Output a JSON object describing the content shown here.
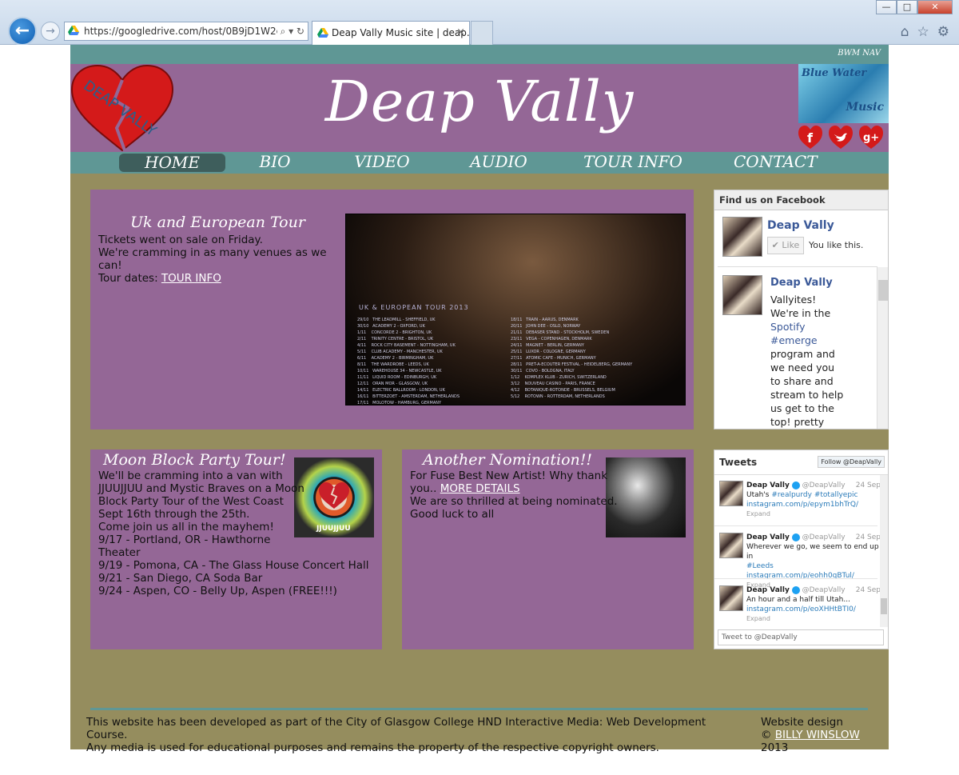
{
  "browser": {
    "url": "https://googledrive.com/host/0B9jD1W2c(",
    "tab_title": "Deap Vally Music site | deap...",
    "tab_close": "×",
    "minimize": "—",
    "maximize": "□",
    "close": "✕",
    "back": "←",
    "forward": "→",
    "addr_controls": "⌕ ▾ ↻",
    "tools": [
      "⌂",
      "☆",
      "⚙"
    ]
  },
  "site": {
    "topbar_label": "BWM NAV",
    "title": "Deap Vally",
    "logo_text": "DEAP VALLY",
    "partner_logo": {
      "line1": "Blue Water",
      "line2": "Music"
    },
    "socials": [
      "facebook-icon",
      "twitter-icon",
      "google-plus-icon"
    ],
    "nav": [
      "HOME",
      "BIO",
      "VIDEO",
      "AUDIO",
      "TOUR INFO",
      "CONTACT"
    ],
    "nav_active": "HOME"
  },
  "tour_panel": {
    "title": "Uk and European Tour",
    "line1": "Tickets went on sale on Friday.",
    "line2": "We're cramming in as many venues as we can!",
    "line3_prefix": "Tour dates: ",
    "line3_link": "TOUR INFO",
    "image_title": "UK & EUROPEAN TOUR 2013",
    "dates_left": "29/10   THE LEADMILL - SHEFFIELD, UK\n30/10   ACADEMY 2 - OXFORD, UK\n1/11    CONCORDE 2 - BRIGHTON, UK\n2/11    TRINITY CENTRE - BRISTOL, UK\n4/11    ROCK CITY BASEMENT - NOTTINGHAM, UK\n5/11    CLUB ACADEMY - MANCHESTER, UK\n6/11    ACADEMY 2 - BIRMINGHAM, UK\n8/11    THE WARDROBE - LEEDS, UK\n10/11   WAREHOUSE 34 - NEWCASTLE, UK\n11/11   LIQUID ROOM - EDINBURGH, UK\n12/11   ORAN MOR - GLASGOW, UK\n14/11   ELECTRIC BALLROOM - LONDON, UK\n16/11   BITTERZOET - AMSTERDAM, NETHERLANDS\n17/11   MOLOTOW - HAMBURG, GERMANY",
    "dates_right": "18/11   TRAIN - AARUS, DENMARK\n20/11   JOHN DEE - OSLO, NORWAY\n21/11   DEBASER STAND - STOCKHOLM, SWEDEN\n23/11   VEGA - COPENHAGEN, DENMARK\n24/11   MAGNET - BERLIN, GERMANY\n25/11   LUXOR - COLOGNE, GERMANY\n27/11   ATOMIC CAFE - MUNICH, GERMANY\n28/11   PRET-A-ECOUTER FESTIVAL - HEIDELBERG, GERMANY\n30/11   COVO - BOLOGNA, ITALY\n1/12    KOMPLEX KLUB - ZURICH, SWITZERLAND\n3/12    NOUVEAU CASINO - PARIS, FRANCE\n4/12    BOTANIQUE-ROTONDE - BRUSSELS, BELGIUM\n5/12    ROTOWN - ROTTERDAM, NETHERLANDS"
  },
  "moon_panel": {
    "title": "Moon Block Party Tour!",
    "lines": [
      "We'll be cramming into a van with",
      "JJUUJJUU and Mystic Braves on a Moon",
      "Block Party Tour of the West Coast",
      "Sept 16th through the 25th.",
      "Come join us all in the mayhem!",
      "9/17 - Portland, OR - Hawthorne",
      "Theater",
      "9/19 - Pomona, CA - The Glass House Concert Hall",
      "9/21 - San Diego, CA Soda Bar",
      "9/24 - Aspen, CO - Belly Up, Aspen (FREE!!!)"
    ],
    "poster_caption": "JJUUJJUU"
  },
  "nomination_panel": {
    "title": "Another Nomination!!",
    "line1": "For Fuse Best New Artist! Why thank",
    "line2_prefix": "you.. ",
    "line2_link": "MORE DETAILS",
    "line3": "We are so thrilled at being nominated.",
    "line4": "Good luck to all"
  },
  "facebook": {
    "header": "Find us on Facebook",
    "page_name": "Deap Vally",
    "like_label": "✔ Like",
    "you_like": "You like this.",
    "post_name": "Deap Vally",
    "post_lines": [
      "Vallyites!",
      "We're in the",
      "Spotify",
      "#emerge",
      "program and",
      "we need you",
      "to share and",
      "stream to help",
      "us get to the",
      "top! pretty"
    ]
  },
  "twitter": {
    "header": "Tweets",
    "follow": "Follow @DeapVally",
    "tweets": [
      {
        "name": "Deap Vally",
        "handle": "@DeapVally",
        "date": "24 Sep",
        "text1": "Utah's ",
        "tag1": "#realpurdy",
        "sep": " ",
        "tag2": "#totallyepic",
        "link": "instagram.com/p/epym1bhTrQ/",
        "expand": "Expand"
      },
      {
        "name": "Deap Vally",
        "handle": "@DeapVally",
        "date": "24 Sep",
        "text1": "Wherever we go, we seem to end up in",
        "tag1": "#Leeds",
        "link": "instagram.com/p/eohh0qBTul/",
        "expand": "Expand"
      },
      {
        "name": "Deap Vally",
        "handle": "@DeapVally",
        "date": "24 Sep",
        "text1": "An hour and a half till Utah...",
        "link": "instagram.com/p/eoXHHtBTI0/",
        "expand": "Expand"
      }
    ],
    "input_placeholder": "Tweet to @DeapVally"
  },
  "footer": {
    "line1": "This website has been developed as part of the City of Glasgow College HND Interactive Media: Web Development Course.",
    "line2": "Any media is used for educational purposes and remains the property of the respective copyright owners.",
    "design_label": "Website design",
    "copyright_prefix": "© ",
    "author_link": "BILLY WINSLOW",
    "year": " 2013"
  },
  "colors": {
    "purple": "#946796",
    "teal": "#5f9795",
    "olive": "#958d5e",
    "nav_active": "#3e5e5c"
  }
}
